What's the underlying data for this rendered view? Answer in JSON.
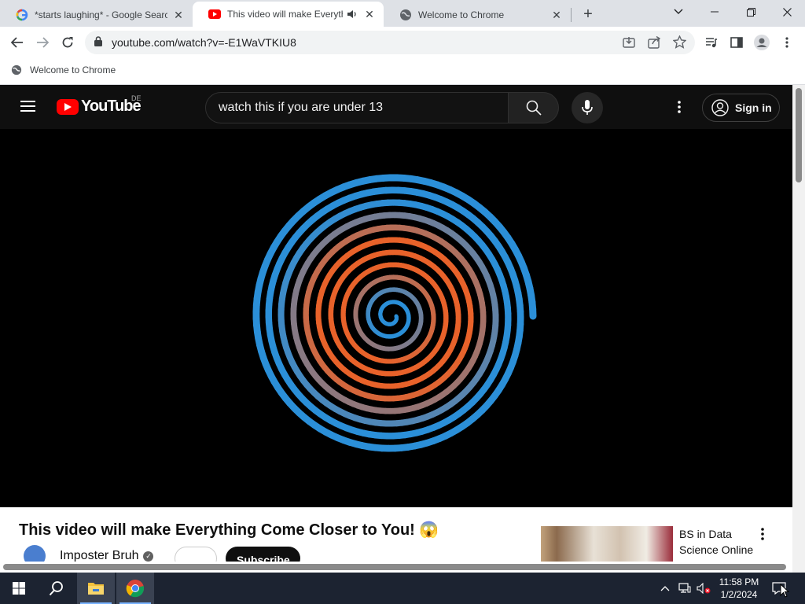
{
  "browser": {
    "tabs": [
      {
        "title": "*starts laughing* - Google Search",
        "active": false
      },
      {
        "title": "This video will make Everything Come Closer to You!",
        "active": true
      },
      {
        "title": "Welcome to Chrome",
        "active": false
      }
    ],
    "url": "youtube.com/watch?v=-E1WaVTKIU8",
    "bookmarks": [
      {
        "label": "Welcome to Chrome"
      }
    ]
  },
  "youtube": {
    "logo_text": "YouTube",
    "country_code": "DE",
    "search_query": "watch this if you are under 13",
    "signin_label": "Sign in",
    "video": {
      "title": "This video will make Everything Come Closer to You! 😱",
      "channel": "Imposter Bruh",
      "subscribe_label": "Subscribe"
    },
    "recommended": [
      {
        "title": "BS in Data Science Online"
      }
    ]
  },
  "taskbar": {
    "time": "11:58 PM",
    "date": "1/2/2024"
  },
  "colors": {
    "youtube_red": "#ff0000",
    "spiral_blue": "#2b8fd8",
    "spiral_orange": "#e8622a",
    "taskbar_bg": "#1c2331"
  }
}
